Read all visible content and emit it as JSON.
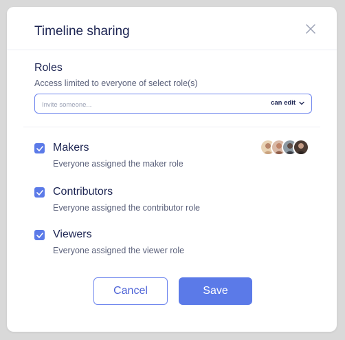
{
  "dialog": {
    "title": "Timeline sharing"
  },
  "roles": {
    "title": "Roles",
    "subtitle": "Access limited to everyone of select role(s)",
    "invite_placeholder": "Invite someone...",
    "permission_label": "can edit"
  },
  "role_list": [
    {
      "name": "Makers",
      "description": "Everyone assigned the maker role",
      "checked": true
    },
    {
      "name": "Contributors",
      "description": "Everyone assigned the contributor role",
      "checked": true
    },
    {
      "name": "Viewers",
      "description": "Everyone assigned the viewer role",
      "checked": true
    }
  ],
  "buttons": {
    "cancel": "Cancel",
    "save": "Save"
  },
  "colors": {
    "accent": "#5b7ae8",
    "border_accent": "#6f86ee",
    "heading": "#1c2452",
    "muted": "#5a607a"
  },
  "icons": {
    "close": "close-icon",
    "dropdown": "chevron-down-icon",
    "check": "check-icon"
  }
}
